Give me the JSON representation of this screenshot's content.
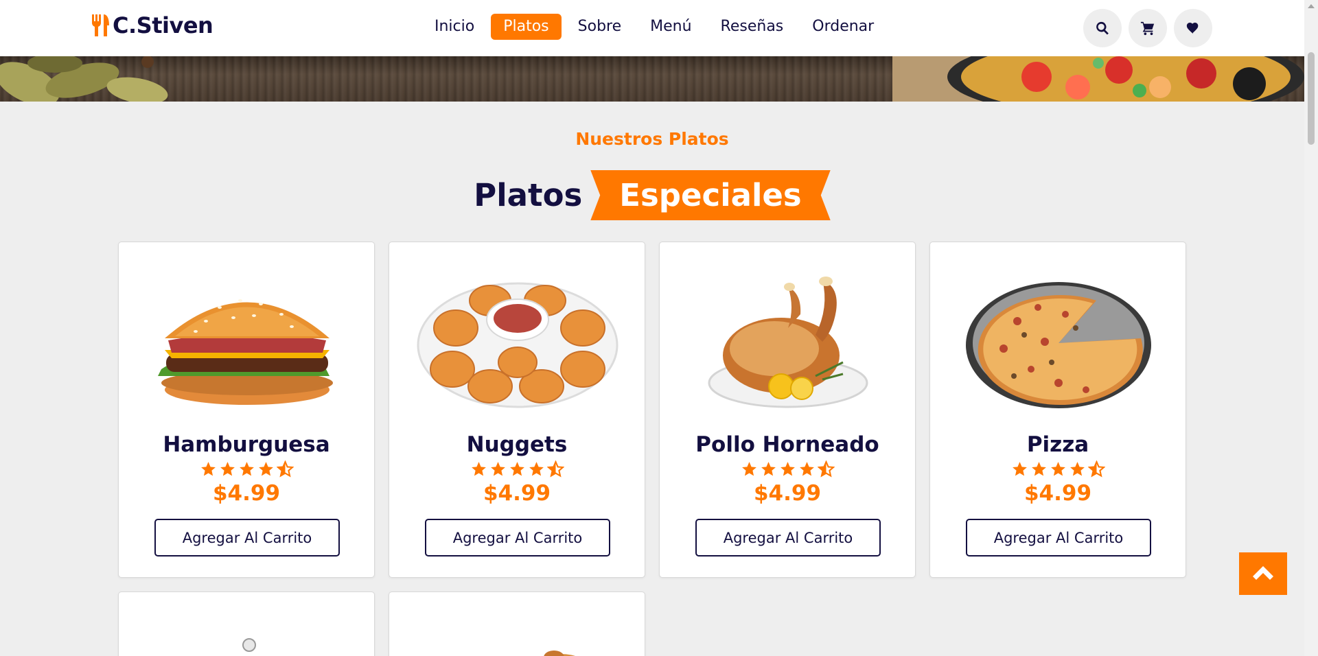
{
  "brand": {
    "name": "C.Stiven",
    "accent": "#ff7800",
    "dark": "#130f40"
  },
  "nav": {
    "items": [
      {
        "label": "Inicio",
        "active": false
      },
      {
        "label": "Platos",
        "active": true
      },
      {
        "label": "Sobre",
        "active": false
      },
      {
        "label": "Menú",
        "active": false
      },
      {
        "label": "Reseñas",
        "active": false
      },
      {
        "label": "Ordenar",
        "active": false
      }
    ]
  },
  "header_icons": [
    "search-icon",
    "cart-icon",
    "heart-icon"
  ],
  "section": {
    "subheading": "Nuestros Platos",
    "heading_plain": "Platos",
    "heading_accent": "Especiales"
  },
  "dishes": [
    {
      "name": "Hamburguesa",
      "price": "$4.99",
      "rating": 4.5,
      "button": "Agregar Al Carrito",
      "image": "burger"
    },
    {
      "name": "Nuggets",
      "price": "$4.99",
      "rating": 4.5,
      "button": "Agregar Al Carrito",
      "image": "nuggets"
    },
    {
      "name": "Pollo Horneado",
      "price": "$4.99",
      "rating": 4.5,
      "button": "Agregar Al Carrito",
      "image": "roast-chicken"
    },
    {
      "name": "Pizza",
      "price": "$4.99",
      "rating": 4.5,
      "button": "Agregar Al Carrito",
      "image": "pizza"
    }
  ],
  "back_to_top_icon": "chevron-up-icon"
}
